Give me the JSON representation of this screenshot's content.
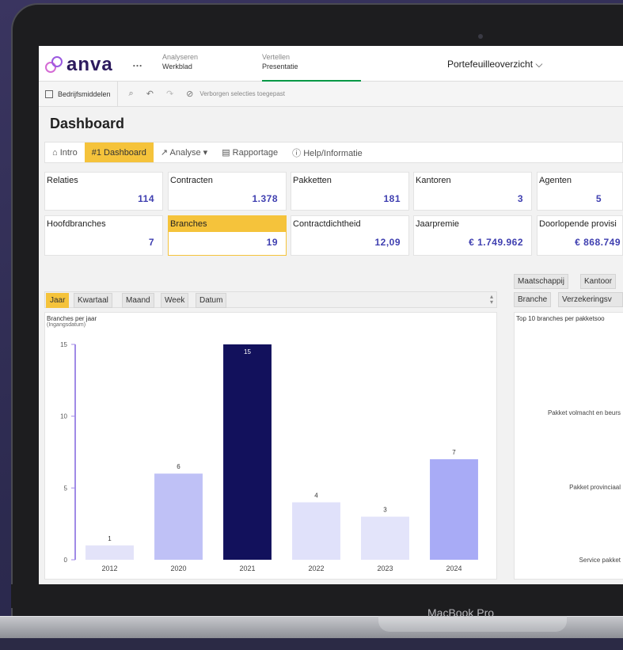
{
  "device": {
    "brand": "MacBook Pro"
  },
  "app": {
    "logo_text": "anva",
    "more_label": "…",
    "tabs": [
      {
        "top": "Analyseren",
        "bottom": "Werkblad"
      },
      {
        "top": "Vertellen",
        "bottom": "Presentatie"
      }
    ],
    "portfolio_label": "Portefeuilleoverzicht ⌵"
  },
  "selection_bar": {
    "assets_label": "Bedrijfsmiddelen",
    "hidden_text": "Verborgen selecties toegepast"
  },
  "page_title": "Dashboard",
  "nav": {
    "items": [
      {
        "label": "⌂ Intro"
      },
      {
        "label": "#1 Dashboard"
      },
      {
        "label": "↗ Analyse ▾"
      },
      {
        "label": "▤ Rapportage"
      },
      {
        "label": "ⓘ Help/Informatie"
      }
    ]
  },
  "kpis": [
    {
      "label": "Relaties",
      "value": "114"
    },
    {
      "label": "Contracten",
      "value": "1.378"
    },
    {
      "label": "Pakketten",
      "value": "181"
    },
    {
      "label": "Kantoren",
      "value": "3"
    },
    {
      "label": "Agenten",
      "value": "5"
    },
    {
      "label": "Hoofdbranches",
      "value": "7"
    },
    {
      "label": "Branches",
      "value": "19"
    },
    {
      "label": "Contractdichtheid",
      "value": "12,09"
    },
    {
      "label": "Jaarpremie",
      "value": "€ 1.749.962"
    },
    {
      "label": "Doorlopende provisi",
      "value": "€ 868.749"
    }
  ],
  "time_filters": [
    "Jaar",
    "Kwartaal",
    "Maand",
    "Week",
    "Datum"
  ],
  "right_filters": [
    "Maatschappij",
    "Kantoor",
    "Branche",
    "Verzekeringsv"
  ],
  "chart_data": {
    "type": "bar",
    "title": "Branches per jaar",
    "subtitle": "(Ingangsdatum)",
    "categories": [
      "2012",
      "2020",
      "2021",
      "2022",
      "2023",
      "2024"
    ],
    "values": [
      1,
      6,
      15,
      4,
      3,
      7
    ],
    "ylim": [
      0,
      15
    ],
    "yticks": [
      0,
      5,
      10,
      15
    ],
    "colors": [
      "#e3e3f9",
      "#bfc1f6",
      "#12115c",
      "#e0e1fa",
      "#e3e4fa",
      "#a8abf6"
    ]
  },
  "right_chart": {
    "title": "Top 10 branches per pakketsoo",
    "labels": [
      "Pakket volmacht en beurs",
      "Pakket provinciaal",
      "Service pakket"
    ]
  }
}
